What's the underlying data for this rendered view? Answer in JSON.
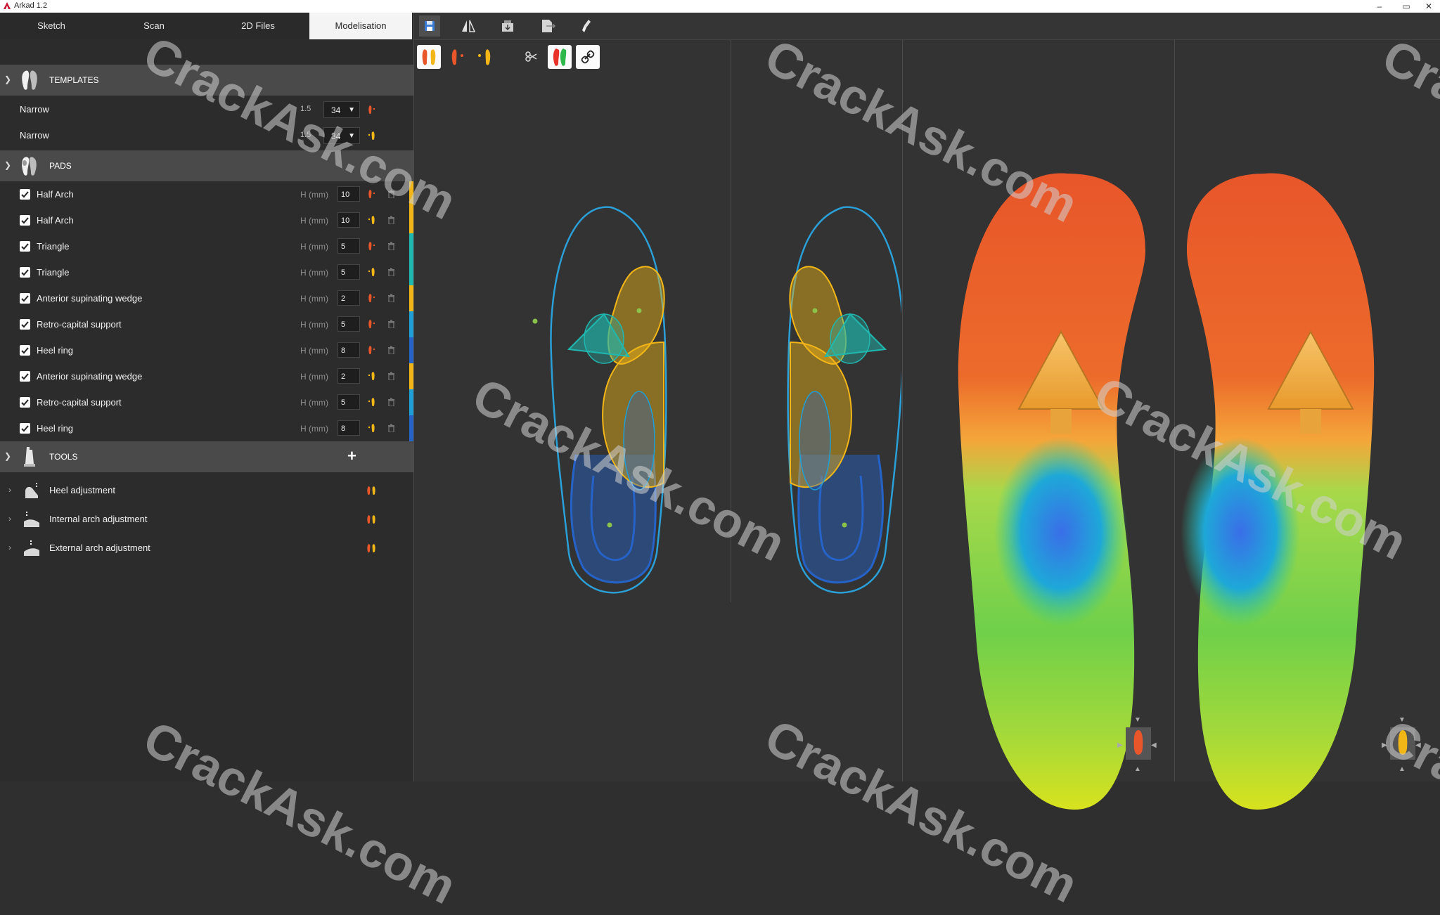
{
  "window": {
    "title": "Arkad 1.2",
    "minimize": "–",
    "restore": "▭",
    "close": "✕"
  },
  "tabs": [
    {
      "label": "Sketch",
      "active": false
    },
    {
      "label": "Scan",
      "active": false
    },
    {
      "label": "2D Files",
      "active": false
    },
    {
      "label": "Modelisation",
      "active": true
    }
  ],
  "templates": {
    "title": "TEMPLATES",
    "rows": [
      {
        "label": "Narrow",
        "num": "1.5",
        "size": "34",
        "side": "right"
      },
      {
        "label": "Narrow",
        "num": "1.5",
        "size": "34",
        "side": "left"
      }
    ]
  },
  "pads": {
    "title": "PADS",
    "unit_label": "H (mm)",
    "rows": [
      {
        "label": "Half Arch",
        "value": "10",
        "side": "right",
        "color": "#f2b616",
        "checked": true
      },
      {
        "label": "Half Arch",
        "value": "10",
        "side": "left",
        "color": "#f2b616",
        "checked": true
      },
      {
        "label": "Triangle",
        "value": "5",
        "side": "right",
        "color": "#1fb8b0",
        "checked": true
      },
      {
        "label": "Triangle",
        "value": "5",
        "side": "left",
        "color": "#1fb8b0",
        "checked": true
      },
      {
        "label": "Anterior supinating wedge",
        "value": "2",
        "side": "right",
        "color": "#f2b616",
        "checked": true
      },
      {
        "label": "Retro-capital support",
        "value": "5",
        "side": "right",
        "color": "#1e9fd8",
        "checked": true
      },
      {
        "label": "Heel ring",
        "value": "8",
        "side": "right",
        "color": "#2563c9",
        "checked": true
      },
      {
        "label": "Anterior supinating wedge",
        "value": "2",
        "side": "left",
        "color": "#f2b616",
        "checked": true
      },
      {
        "label": "Retro-capital support",
        "value": "5",
        "side": "left",
        "color": "#1e9fd8",
        "checked": true
      },
      {
        "label": "Heel ring",
        "value": "8",
        "side": "left",
        "color": "#2563c9",
        "checked": true
      }
    ]
  },
  "tools": {
    "title": "TOOLS",
    "add_label": "+",
    "rows": [
      {
        "label": "Heel adjustment"
      },
      {
        "label": "Internal arch adjustment"
      },
      {
        "label": "External arch adjustment"
      }
    ]
  },
  "toolbar": {
    "icons": [
      "save-icon",
      "mirror-icon",
      "import-icon",
      "export-icon",
      "brush-icon"
    ],
    "view_icons": [
      "both-feet-icon",
      "right-foot-icon",
      "left-foot-icon",
      "scissors-icon",
      "color-map-icon",
      "link-icon"
    ]
  },
  "watermark": "CrackAsk.com",
  "colors": {
    "right_foot": "#e8562a",
    "left_foot": "#f2b616",
    "panel": "#2c2c2c",
    "section": "#4a4a4a"
  }
}
